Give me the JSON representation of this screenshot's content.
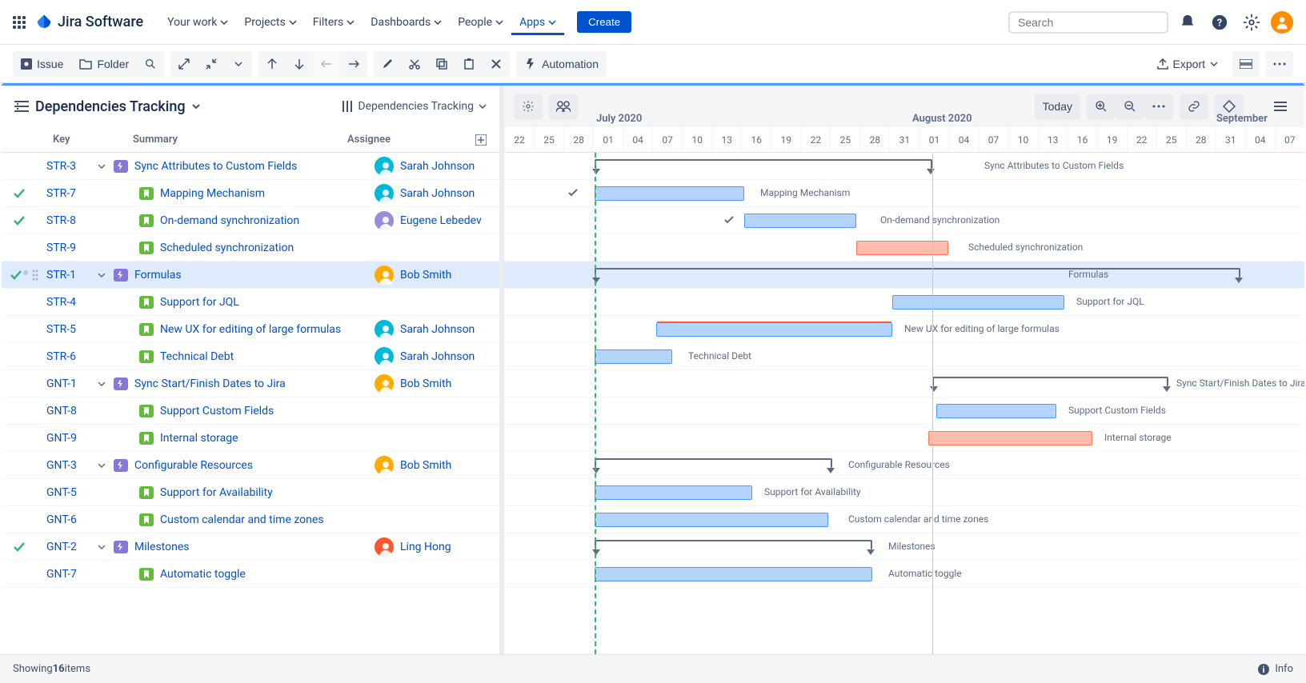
{
  "brand": "Jira Software",
  "nav": {
    "items": [
      "Your work",
      "Projects",
      "Filters",
      "Dashboards",
      "People",
      "Apps"
    ],
    "active": "Apps",
    "create": "Create",
    "search_placeholder": "Search"
  },
  "toolbar": {
    "issue": "Issue",
    "folder": "Folder",
    "automation": "Automation",
    "export": "Export"
  },
  "panel": {
    "title": "Dependencies Tracking",
    "view": "Dependencies Tracking",
    "columns": {
      "key": "Key",
      "summary": "Summary",
      "assignee": "Assignee"
    }
  },
  "gantt_toolbar": {
    "today": "Today"
  },
  "timeline": {
    "months": [
      {
        "label": "July 2020",
        "pos": 11.5
      },
      {
        "label": "August 2020",
        "pos": 51
      },
      {
        "label": "September",
        "pos": 89
      }
    ],
    "days": [
      "22",
      "25",
      "28",
      "01",
      "04",
      "07",
      "10",
      "13",
      "16",
      "19",
      "22",
      "25",
      "28",
      "31",
      "01",
      "04",
      "07",
      "10",
      "13",
      "16",
      "19",
      "22",
      "25",
      "28",
      "31",
      "04",
      "07"
    ],
    "today_pos": 11.3,
    "month_line_pos": 53.5
  },
  "rows": [
    {
      "key": "STR-3",
      "summary": "Sync Attributes to Custom Fields",
      "assignee": "Sarah Johnson",
      "avatar": "#00B8D9",
      "type": "epic",
      "level": 0,
      "expandable": true,
      "done": false,
      "bar": {
        "kind": "bracket",
        "start": 11.3,
        "end": 53.5
      },
      "label": "Sync Attributes to Custom Fields",
      "labelPos": 60
    },
    {
      "key": "STR-7",
      "summary": "Mapping Mechanism",
      "assignee": "Sarah Johnson",
      "avatar": "#00B8D9",
      "type": "story",
      "level": 1,
      "done": true,
      "bar": {
        "kind": "blue",
        "start": 11.3,
        "end": 30
      },
      "label": "Mapping Mechanism",
      "labelPos": 32,
      "check": {
        "pos": 8
      }
    },
    {
      "key": "STR-8",
      "summary": "On-demand synchronization",
      "assignee": "Eugene Lebedev",
      "avatar": "#998DD9",
      "type": "story",
      "level": 1,
      "done": true,
      "bar": {
        "kind": "blue",
        "start": 30,
        "end": 44
      },
      "label": "On-demand synchronization",
      "labelPos": 47,
      "check": {
        "pos": 27.5
      }
    },
    {
      "key": "STR-9",
      "summary": "Scheduled synchronization",
      "assignee": "",
      "avatar": "",
      "type": "story",
      "level": 1,
      "done": false,
      "bar": {
        "kind": "red",
        "start": 44,
        "end": 55.5
      },
      "label": "Scheduled synchronization",
      "labelPos": 58
    },
    {
      "key": "STR-1",
      "summary": "Formulas",
      "assignee": "Bob Smith",
      "avatar": "#FFAB00",
      "type": "epic",
      "level": 0,
      "expandable": true,
      "done": true,
      "selected": true,
      "bar": {
        "kind": "bracket",
        "start": 11.3,
        "end": 92
      },
      "label": "Formulas",
      "labelPos": 70.5
    },
    {
      "key": "STR-4",
      "summary": "Support for JQL",
      "assignee": "",
      "avatar": "",
      "type": "story",
      "level": 1,
      "done": false,
      "bar": {
        "kind": "blue",
        "start": 48.5,
        "end": 70
      },
      "label": "Support for JQL",
      "labelPos": 71.5
    },
    {
      "key": "STR-5",
      "summary": "New UX for editing of large formulas",
      "assignee": "Sarah Johnson",
      "avatar": "#00B8D9",
      "type": "story",
      "level": 1,
      "done": false,
      "bar": {
        "kind": "blue",
        "start": 19,
        "end": 48.5,
        "overdue": true
      },
      "label": "New UX for editing of large formulas",
      "labelPos": 50
    },
    {
      "key": "STR-6",
      "summary": "Technical Debt",
      "assignee": "Sarah Johnson",
      "avatar": "#00B8D9",
      "type": "story",
      "level": 1,
      "done": false,
      "bar": {
        "kind": "blue",
        "start": 11.3,
        "end": 21
      },
      "label": "Technical Debt",
      "labelPos": 23
    },
    {
      "key": "GNT-1",
      "summary": "Sync Start/Finish Dates to Jira",
      "assignee": "Bob Smith",
      "avatar": "#FFAB00",
      "type": "epic",
      "level": 0,
      "expandable": true,
      "done": false,
      "bar": {
        "kind": "bracket",
        "start": 53.5,
        "end": 83
      },
      "label": "Sync Start/Finish Dates to Jira",
      "labelPos": 84
    },
    {
      "key": "GNT-8",
      "summary": "Support Custom Fields",
      "assignee": "",
      "avatar": "",
      "type": "story",
      "level": 1,
      "done": false,
      "bar": {
        "kind": "blue",
        "start": 54,
        "end": 69
      },
      "label": "Support Custom Fields",
      "labelPos": 70.5
    },
    {
      "key": "GNT-9",
      "summary": "Internal storage",
      "assignee": "",
      "avatar": "",
      "type": "story",
      "level": 1,
      "done": false,
      "bar": {
        "kind": "red",
        "start": 53,
        "end": 73.5
      },
      "label": "Internal storage",
      "labelPos": 75
    },
    {
      "key": "GNT-3",
      "summary": "Configurable Resources",
      "assignee": "Bob Smith",
      "avatar": "#FFAB00",
      "type": "epic",
      "level": 0,
      "expandable": true,
      "done": false,
      "bar": {
        "kind": "bracket",
        "start": 11.3,
        "end": 41
      },
      "label": "Configurable Resources",
      "labelPos": 43
    },
    {
      "key": "GNT-5",
      "summary": "Support for Availability",
      "assignee": "",
      "avatar": "",
      "type": "story",
      "level": 1,
      "done": false,
      "bar": {
        "kind": "blue",
        "start": 11.3,
        "end": 31
      },
      "label": "Support for Availability",
      "labelPos": 32.5
    },
    {
      "key": "GNT-6",
      "summary": "Custom calendar and time zones",
      "assignee": "",
      "avatar": "",
      "type": "story",
      "level": 1,
      "done": false,
      "bar": {
        "kind": "blue",
        "start": 11.3,
        "end": 40.5
      },
      "label": "Custom calendar and time zones",
      "labelPos": 43
    },
    {
      "key": "GNT-2",
      "summary": "Milestones",
      "assignee": "Ling Hong",
      "avatar": "#FF5630",
      "type": "epic",
      "level": 0,
      "expandable": true,
      "done": true,
      "bar": {
        "kind": "bracket",
        "start": 11.3,
        "end": 46
      },
      "label": "Milestones",
      "labelPos": 48
    },
    {
      "key": "GNT-7",
      "summary": "Automatic toggle",
      "assignee": "",
      "avatar": "",
      "type": "story",
      "level": 1,
      "done": false,
      "bar": {
        "kind": "blue",
        "start": 11.3,
        "end": 46
      },
      "label": "Automatic toggle",
      "labelPos": 48
    }
  ],
  "footer": {
    "showing_prefix": "Showing ",
    "count": "16",
    "showing_suffix": " items",
    "info": "Info"
  }
}
